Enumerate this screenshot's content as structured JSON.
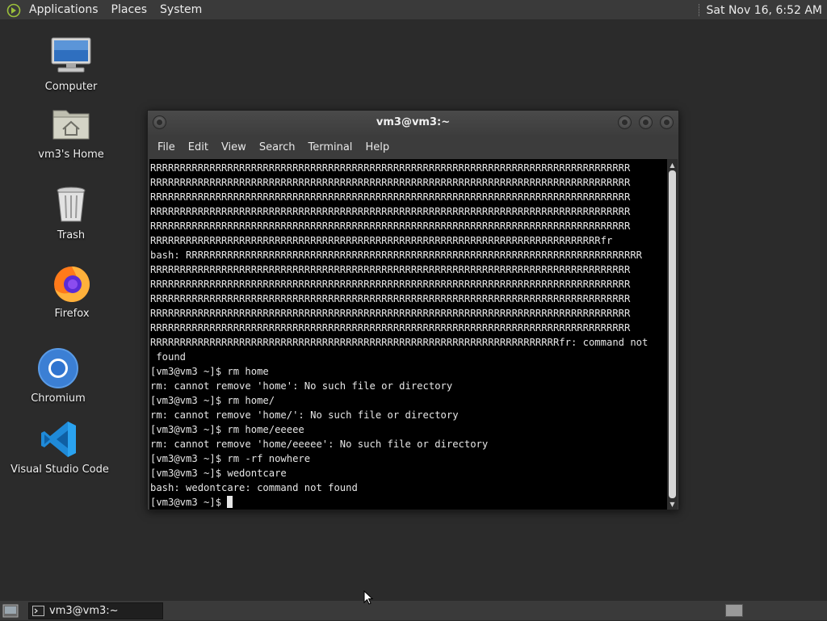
{
  "top_panel": {
    "menus": [
      "Applications",
      "Places",
      "System"
    ],
    "clock": "Sat Nov 16,  6:52 AM"
  },
  "desktop_icons": [
    {
      "label": "Computer",
      "icon": "computer-icon"
    },
    {
      "label": "vm3's Home",
      "icon": "home-folder-icon"
    },
    {
      "label": "Trash",
      "icon": "trash-icon"
    },
    {
      "label": "Firefox",
      "icon": "firefox-icon"
    },
    {
      "label": "Chromium",
      "icon": "chromium-icon"
    },
    {
      "label": "Visual Studio Code",
      "icon": "vscode-icon"
    }
  ],
  "window": {
    "title": "vm3@vm3:~",
    "menu": [
      "File",
      "Edit",
      "View",
      "Search",
      "Terminal",
      "Help"
    ]
  },
  "terminal": {
    "lines": [
      "RRRRRRRRRRRRRRRRRRRRRRRRRRRRRRRRRRRRRRRRRRRRRRRRRRRRRRRRRRRRRRRRRRRRRRRRRRRRRRRRR",
      "RRRRRRRRRRRRRRRRRRRRRRRRRRRRRRRRRRRRRRRRRRRRRRRRRRRRRRRRRRRRRRRRRRRRRRRRRRRRRRRRR",
      "RRRRRRRRRRRRRRRRRRRRRRRRRRRRRRRRRRRRRRRRRRRRRRRRRRRRRRRRRRRRRRRRRRRRRRRRRRRRRRRRR",
      "RRRRRRRRRRRRRRRRRRRRRRRRRRRRRRRRRRRRRRRRRRRRRRRRRRRRRRRRRRRRRRRRRRRRRRRRRRRRRRRRR",
      "RRRRRRRRRRRRRRRRRRRRRRRRRRRRRRRRRRRRRRRRRRRRRRRRRRRRRRRRRRRRRRRRRRRRRRRRRRRRRRRRR",
      "RRRRRRRRRRRRRRRRRRRRRRRRRRRRRRRRRRRRRRRRRRRRRRRRRRRRRRRRRRRRRRRRRRRRRRRRRRRRfr",
      "bash: RRRRRRRRRRRRRRRRRRRRRRRRRRRRRRRRRRRRRRRRRRRRRRRRRRRRRRRRRRRRRRRRRRRRRRRRRRRRR",
      "RRRRRRRRRRRRRRRRRRRRRRRRRRRRRRRRRRRRRRRRRRRRRRRRRRRRRRRRRRRRRRRRRRRRRRRRRRRRRRRRR",
      "RRRRRRRRRRRRRRRRRRRRRRRRRRRRRRRRRRRRRRRRRRRRRRRRRRRRRRRRRRRRRRRRRRRRRRRRRRRRRRRRR",
      "RRRRRRRRRRRRRRRRRRRRRRRRRRRRRRRRRRRRRRRRRRRRRRRRRRRRRRRRRRRRRRRRRRRRRRRRRRRRRRRRR",
      "RRRRRRRRRRRRRRRRRRRRRRRRRRRRRRRRRRRRRRRRRRRRRRRRRRRRRRRRRRRRRRRRRRRRRRRRRRRRRRRRR",
      "RRRRRRRRRRRRRRRRRRRRRRRRRRRRRRRRRRRRRRRRRRRRRRRRRRRRRRRRRRRRRRRRRRRRRRRRRRRRRRRRR",
      "RRRRRRRRRRRRRRRRRRRRRRRRRRRRRRRRRRRRRRRRRRRRRRRRRRRRRRRRRRRRRRRRRRRRRfr: command not",
      " found",
      "[vm3@vm3 ~]$ rm home",
      "rm: cannot remove 'home': No such file or directory",
      "[vm3@vm3 ~]$ rm home/",
      "rm: cannot remove 'home/': No such file or directory",
      "[vm3@vm3 ~]$ rm home/eeeee",
      "rm: cannot remove 'home/eeeee': No such file or directory",
      "[vm3@vm3 ~]$ rm -rf nowhere",
      "[vm3@vm3 ~]$ wedontcare",
      "bash: wedontcare: command not found"
    ],
    "prompt": "[vm3@vm3 ~]$ "
  },
  "taskbar": {
    "task_label": "vm3@vm3:~"
  },
  "colors": {
    "panel_bg": "#3a3a3a",
    "desktop_bg": "#2b2b2b",
    "terminal_bg": "#000000",
    "terminal_fg": "#e6e6e6"
  }
}
